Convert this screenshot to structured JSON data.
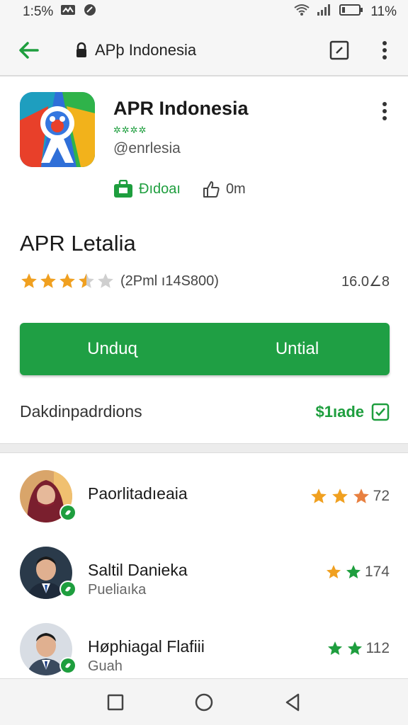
{
  "status_bar": {
    "time": "1:5%",
    "battery": "11%",
    "icons": [
      "video-icon",
      "location-icon",
      "wifi-icon",
      "signal-icon",
      "battery-icon"
    ]
  },
  "address_bar": {
    "url_text": "APþ Indonesia",
    "icons": [
      "back-arrow-icon",
      "lock-icon",
      "edit-icon",
      "more-vert-icon"
    ],
    "accent": "#1e9e3e"
  },
  "app": {
    "name": "APR Indonesia",
    "badge": "✲✲✲✲",
    "developer": "@enrlesia",
    "meta_install": "Đıdoaı",
    "meta_likes": "0m",
    "section_title": "APR Letalia",
    "rating_stars": 3.5,
    "rating_count": "(2Pml ı14S800)",
    "size": "16.0∠8",
    "install_left": "Unduɋ",
    "install_right": "Untial",
    "description_label": "Dakdinpadrdions",
    "description_link": "$1ıade"
  },
  "reviews": [
    {
      "name": "Paorlitadıeaia",
      "subtitle": "",
      "stars": 3,
      "star_colors": [
        "#f0a020",
        "#f0a020",
        "#e88040"
      ],
      "count": "72"
    },
    {
      "name": "Saltil Danieka",
      "subtitle": "Pueliaıka",
      "stars": 2,
      "star_colors": [
        "#f0a020",
        "#1e9e3e"
      ],
      "count": "174"
    },
    {
      "name": "Høphiagal Flafiii",
      "subtitle": "Guah",
      "stars": 2,
      "star_colors": [
        "#1e9e3e",
        "#1e9e3e"
      ],
      "count": "112"
    }
  ],
  "colors": {
    "primary_green": "#1f9f44",
    "star_orange": "#f0a020"
  },
  "nav_icons": [
    "recent-apps-icon",
    "home-icon",
    "back-icon"
  ]
}
